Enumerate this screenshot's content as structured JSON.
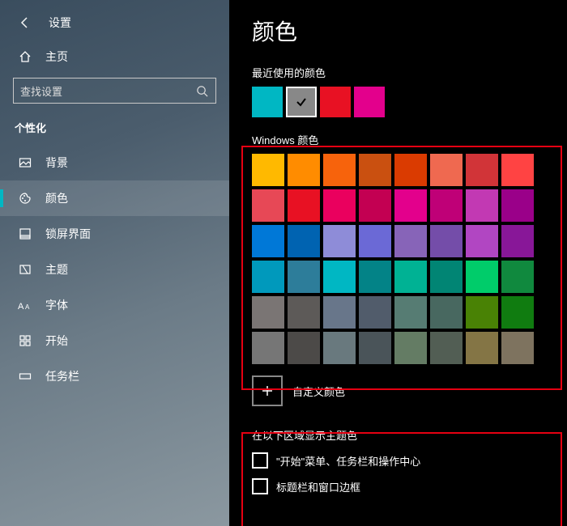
{
  "header": {
    "title": "设置"
  },
  "home_label": "主页",
  "search": {
    "placeholder": "查找设置"
  },
  "section_label": "个性化",
  "sidebar": {
    "items": [
      {
        "label": "背景"
      },
      {
        "label": "颜色"
      },
      {
        "label": "锁屏界面"
      },
      {
        "label": "主题"
      },
      {
        "label": "字体"
      },
      {
        "label": "开始"
      },
      {
        "label": "任务栏"
      }
    ]
  },
  "main": {
    "title": "颜色",
    "recent_label": "最近使用的颜色",
    "recent_colors": [
      "#00b7c3",
      "#888888",
      "#e81123",
      "#e3008c"
    ],
    "recent_selected_index": 1,
    "palette_label": "Windows 颜色",
    "palette": [
      "#ffb900",
      "#ff8c00",
      "#f7630c",
      "#ca5010",
      "#da3b01",
      "#ef6950",
      "#d13438",
      "#ff4343",
      "#e74856",
      "#e81123",
      "#ea005e",
      "#c30052",
      "#e3008c",
      "#bf0077",
      "#c239b3",
      "#9a0089",
      "#0078d7",
      "#0063b1",
      "#8e8cd8",
      "#6b69d6",
      "#8764b8",
      "#744da9",
      "#b146c2",
      "#881798",
      "#0099bc",
      "#2d7d9a",
      "#00b7c3",
      "#038387",
      "#00b294",
      "#018574",
      "#00cc6a",
      "#10893e",
      "#7a7574",
      "#5d5a58",
      "#68768a",
      "#515c6b",
      "#567c73",
      "#486860",
      "#498205",
      "#107c10",
      "#767676",
      "#4c4a48",
      "#69797e",
      "#4a5459",
      "#647c64",
      "#525e54",
      "#847545",
      "#7e735f"
    ],
    "custom_label": "自定义颜色",
    "accent_section_label": "在以下区域显示主题色",
    "checkboxes": [
      {
        "label": "\"开始\"菜单、任务栏和操作中心"
      },
      {
        "label": "标题栏和窗口边框"
      }
    ]
  }
}
